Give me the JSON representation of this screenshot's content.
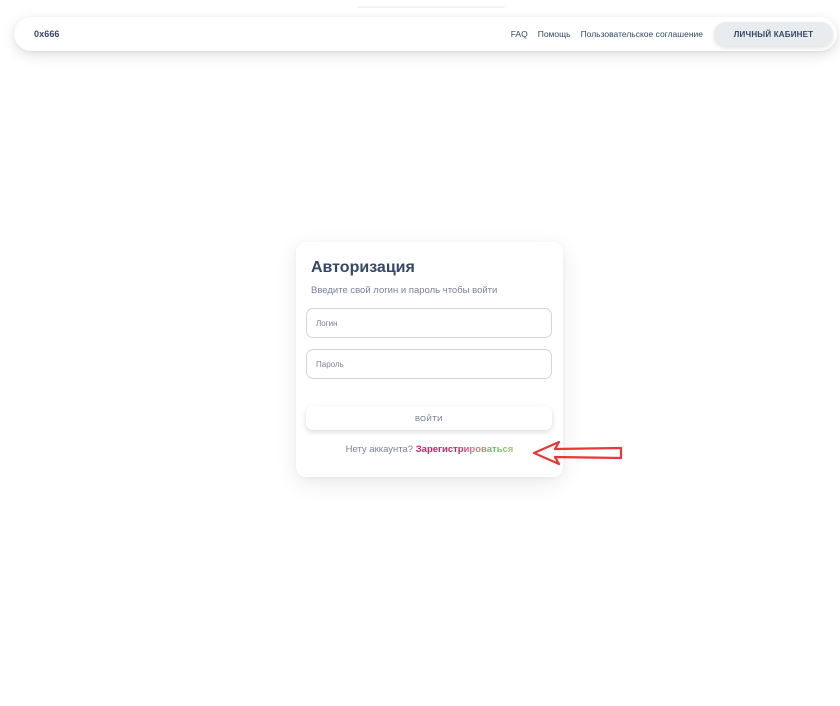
{
  "navbar": {
    "brand": "0x666",
    "links": [
      "FAQ",
      "Помощь",
      "Пользовательское соглашение"
    ],
    "cabinet_button": "ЛИЧНЫЙ КАБИНЕТ"
  },
  "auth": {
    "title": "Авторизация",
    "subtitle": "Введите свой логин и пароль чтобы войти",
    "login_placeholder": "Логин",
    "password_placeholder": "Пароль",
    "submit_label": "ВОЙТИ",
    "no_account_text": "Нету аккаунта?",
    "register_link": "Зарегистрироваться"
  },
  "colors": {
    "primary_text": "#344767",
    "muted_text": "#7b809a",
    "register_gradient_start": "#d81b60",
    "register_gradient_end": "#66bb6a",
    "annotation_arrow": "#e53935"
  },
  "icons": {
    "annotation": "red-arrow-icon"
  }
}
